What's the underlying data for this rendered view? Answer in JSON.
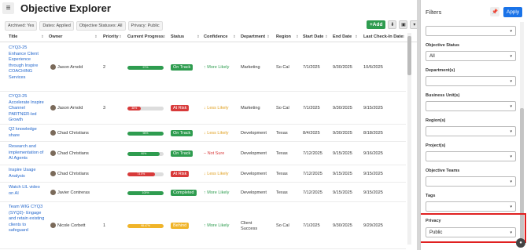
{
  "app": {
    "title": "Objective Explorer",
    "menu_icon": "hamburger-icon",
    "chips": [
      "Archived: Yes",
      "Dates: Applied",
      "Objective Statuses: All",
      "Privacy: Public"
    ],
    "add_label": "+Add",
    "export_icon": "download-icon",
    "save_icon": "save-icon",
    "more_icon": "chevron-down-icon"
  },
  "columns": [
    "Title",
    "Owner",
    "Priority",
    "Current Progress",
    "Status",
    "Confidence",
    "Department",
    "Region",
    "Start Date",
    "End Date",
    "Last Check-In Date"
  ],
  "colors": {
    "on_track": "#2e9c4f",
    "at_risk": "#d83a3a",
    "completed": "#2e9c4f",
    "behind": "#f0b429",
    "link": "#2266cc",
    "apply": "#1a73e8",
    "highlight": "#e02020"
  },
  "rows": [
    {
      "title": "CYQ3-25 Enhance Client Experience through Inspire COACHING Services",
      "owner": "Jason Arnold",
      "priority": "2",
      "progress": 100,
      "progress_label": "97%",
      "status": "On Track",
      "status_color": "#2e9c4f",
      "confidence": "More Likely",
      "conf_color": "#2e9c4f",
      "conf_icon": "arrow-up-icon",
      "department": "Marketing",
      "region": "So Cal",
      "start": "7/1/2025",
      "end": "9/30/2025",
      "checkin": "10/6/2025"
    },
    {
      "title": "CYQ3-25 Accelerate Inspire Channel PARTNER-led Growth",
      "owner": "Jason Arnold",
      "priority": "3",
      "progress": 38,
      "progress_label": "38%",
      "status": "At Risk",
      "status_color": "#d83a3a",
      "confidence": "Less Likely",
      "conf_color": "#e0a020",
      "conf_icon": "arrow-down-icon",
      "department": "Marketing",
      "region": "So Cal",
      "start": "7/1/2025",
      "end": "9/30/2025",
      "checkin": "9/15/2025"
    },
    {
      "title": "Q2 knowledge share",
      "owner": "Chad Christians",
      "priority": "",
      "progress": 100,
      "progress_label": "96%",
      "status": "On Track",
      "status_color": "#2e9c4f",
      "confidence": "Less Likely",
      "conf_color": "#e0a020",
      "conf_icon": "arrow-down-icon",
      "department": "Development",
      "region": "Texas",
      "start": "8/4/2025",
      "end": "9/30/2025",
      "checkin": "8/18/2025"
    },
    {
      "title": "Research and implementation of AI Agents",
      "owner": "Chad Christians",
      "priority": "",
      "progress": 90,
      "progress_label": "90%",
      "status": "On Track",
      "status_color": "#2e9c4f",
      "confidence": "Not Sure",
      "conf_color": "#d83a3a",
      "conf_icon": "dash-icon",
      "department": "Development",
      "region": "Texas",
      "start": "7/12/2025",
      "end": "9/15/2025",
      "checkin": "9/16/2025"
    },
    {
      "title": "Inspire Usage Analysis",
      "owner": "Chad Christians",
      "priority": "",
      "progress": 75,
      "progress_label": "73.5%",
      "status": "At Risk",
      "status_color": "#d83a3a",
      "confidence": "Less Likely",
      "conf_color": "#e0a020",
      "conf_icon": "arrow-down-icon",
      "department": "Development",
      "region": "Texas",
      "start": "7/12/2025",
      "end": "9/15/2025",
      "checkin": "9/15/2025"
    },
    {
      "title": "Watch LIL video on AI",
      "owner": "Javier Contreras",
      "priority": "",
      "progress": 100,
      "progress_label": "100%",
      "status": "Completed",
      "status_color": "#2e9c4f",
      "confidence": "More Likely",
      "conf_color": "#2e9c4f",
      "conf_icon": "arrow-up-icon",
      "department": "Development",
      "region": "Texas",
      "start": "7/12/2025",
      "end": "9/15/2025",
      "checkin": "9/15/2025"
    },
    {
      "title": "Team WIG CYQ3 (SYQ2)- Engage and retain existing clients to safeguard",
      "owner": "Nicole Corbett",
      "priority": "1",
      "progress": 100,
      "progress_label": "98.47%",
      "status": "Behind",
      "status_color": "#f0b429",
      "confidence": "More Likely",
      "conf_color": "#2e9c4f",
      "conf_icon": "arrow-up-icon",
      "department": "Client Success",
      "region": "So Cal",
      "start": "7/1/2025",
      "end": "9/30/2025",
      "checkin": "9/29/2025"
    }
  ],
  "filters": {
    "title": "Filters",
    "pin_icon": "pin-icon",
    "apply_label": "Apply",
    "fields": [
      {
        "label": "",
        "value": ""
      },
      {
        "label": "Objective Status",
        "value": "All"
      },
      {
        "label": "Department(s)",
        "value": ""
      },
      {
        "label": "Business Unit(s)",
        "value": ""
      },
      {
        "label": "Region(s)",
        "value": ""
      },
      {
        "label": "Project(s)",
        "value": ""
      },
      {
        "label": "Objective Teams",
        "value": ""
      },
      {
        "label": "Tags",
        "value": ""
      },
      {
        "label": "Privacy",
        "value": "Public"
      }
    ]
  }
}
